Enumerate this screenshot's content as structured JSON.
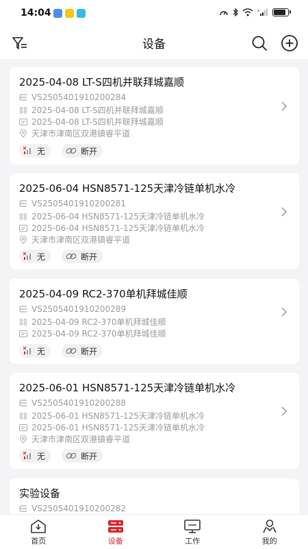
{
  "status": {
    "time": "14:04"
  },
  "header": {
    "title": "设备",
    "filter_icon": "filter-icon",
    "search_icon": "search-icon",
    "add_icon": "add-icon"
  },
  "devices": [
    {
      "title": "2025-04-08 LT-S四机并联拜城嘉顺",
      "serial": "VS2505401910200284",
      "name": "2025-04-08 LT-S四机并联拜城嘉顺",
      "model": "2025-04-08 LT-S四机并联拜城嘉顺",
      "address": "天津市津南区双港镇睿平道",
      "signal": "无",
      "connection": "断开"
    },
    {
      "title": "2025-06-04 HSN8571-125天津冷链单机水冷",
      "serial": "VS2505401910200281",
      "name": "2025-06-04 HSN8571-125天津冷链单机水冷",
      "model": "2025-06-04 HSN8571-125天津冷链单机水冷",
      "address": "天津市津南区双港镇睿平道",
      "signal": "无",
      "connection": "断开"
    },
    {
      "title": "2025-04-09 RC2-370单机拜城佳顺",
      "serial": "VS2505401910200289",
      "name": "2025-04-09 RC2-370单机拜城佳顺",
      "model": "2025-04-09 RC2-370单机拜城佳顺",
      "signal": "无",
      "connection": "断开"
    },
    {
      "title": "2025-06-01 HSN8571-125天津冷链单机水冷",
      "serial": "VS2505401910200288",
      "name": "2025-06-01 HSN8571-125天津冷链单机水冷",
      "model": "2025-06-01 HSN8571-125天津冷链单机水冷",
      "address": "天津市津南区双港镇睿平道",
      "signal": "无",
      "connection": "断开"
    },
    {
      "title": "实验设备",
      "serial": "VS2505401910200282"
    }
  ],
  "tabs": [
    {
      "label": "首页",
      "icon": "home-icon",
      "active": false
    },
    {
      "label": "设备",
      "icon": "device-icon",
      "active": true
    },
    {
      "label": "工作",
      "icon": "monitor-icon",
      "active": false
    },
    {
      "label": "我的",
      "icon": "user-icon",
      "active": false
    }
  ],
  "colors": {
    "accent": "#d8262c",
    "muted": "#9a9a9a"
  }
}
